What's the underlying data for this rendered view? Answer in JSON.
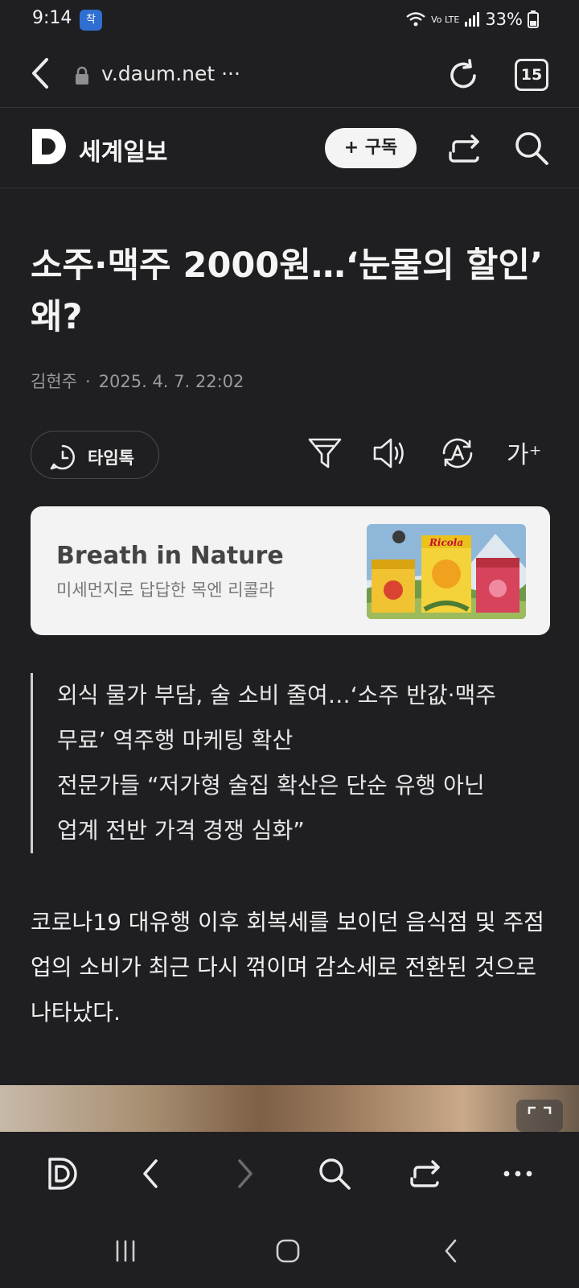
{
  "status": {
    "time": "9:14",
    "app_badge": "착",
    "network": "Vo LTE",
    "battery": "33%"
  },
  "browser": {
    "url": "v.daum.net ···",
    "tab_count": "15"
  },
  "site": {
    "name": "세계일보",
    "subscribe_label": "+ 구독"
  },
  "article": {
    "headline": "소주·맥주 2000원…‘눈물의 할인’ 왜?",
    "author": "김현주",
    "date": "2025. 4. 7. 22:02",
    "timetalk_label": "타임톡",
    "font_size_label": "가⁺",
    "summary_lines": [
      "외식 물가 부담, 술 소비 줄여…‘소주 반값·맥주",
      "무료’ 역주행 마케팅 확산",
      "전문가들 “저가형 술집 확산은 단순 유행 아닌",
      "업계 전반 가격 경쟁 심화”"
    ],
    "body": "코로나19 대유행 이후 회복세를 보이던 음식점 및 주점업의 소비가 최근 다시 꺾이며 감소세로 전환된 것으로 나타났다."
  },
  "ad": {
    "title": "Breath in Nature",
    "subtitle": "미세먼지로 답답한 목엔 리콜라",
    "brand": "Ricola"
  },
  "icons": [
    "back-icon",
    "lock-icon",
    "reload-icon",
    "share-icon",
    "search-icon",
    "clock-chat-icon",
    "filter-icon",
    "speaker-icon",
    "translate-icon",
    "expand-icon",
    "more-icon",
    "recent-apps-icon",
    "home-icon",
    "nav-back-icon"
  ]
}
